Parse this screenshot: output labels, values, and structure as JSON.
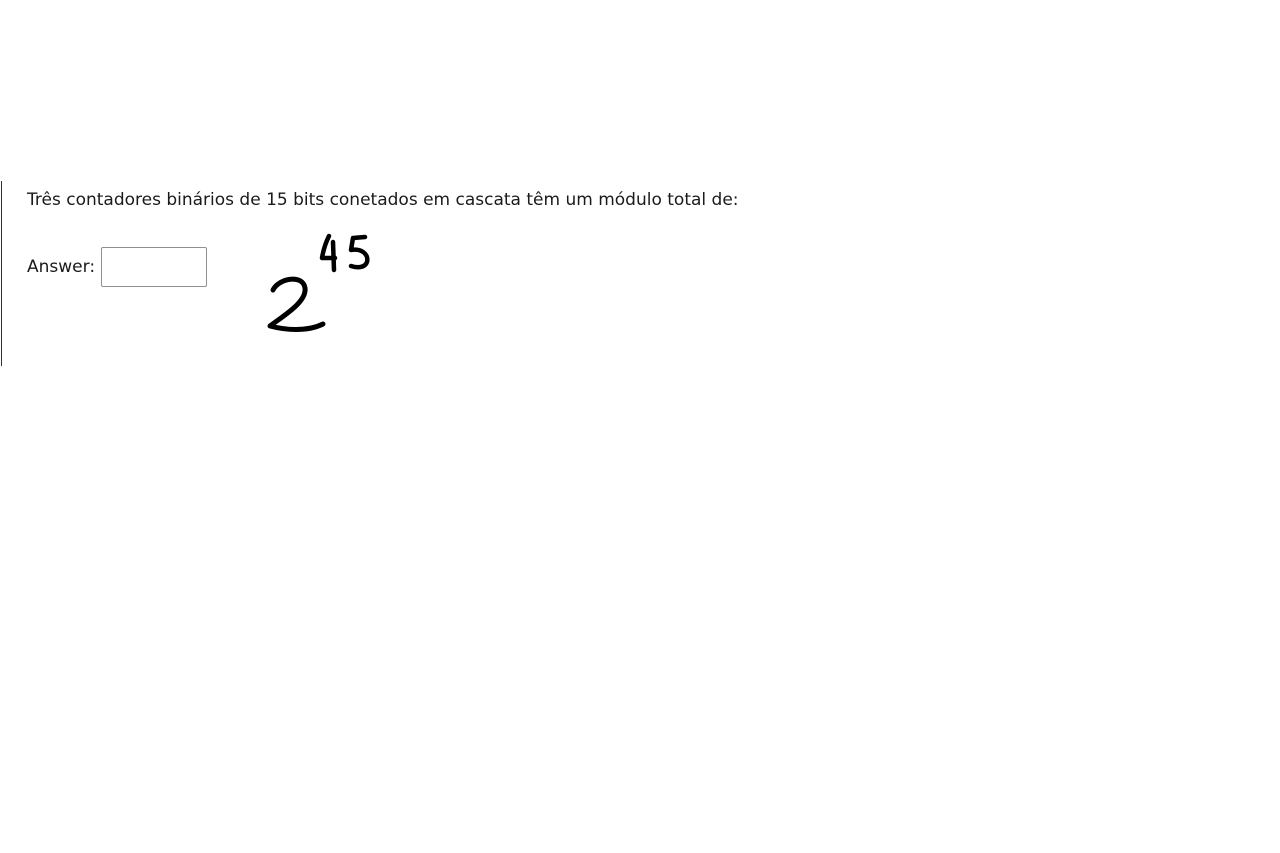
{
  "question": {
    "text": "Três contadores binários de 15 bits conetados em cascata têm um módulo total de:",
    "answer_label": "Answer:",
    "answer_value": ""
  },
  "annotation": {
    "base": "2",
    "exponent": "45"
  }
}
